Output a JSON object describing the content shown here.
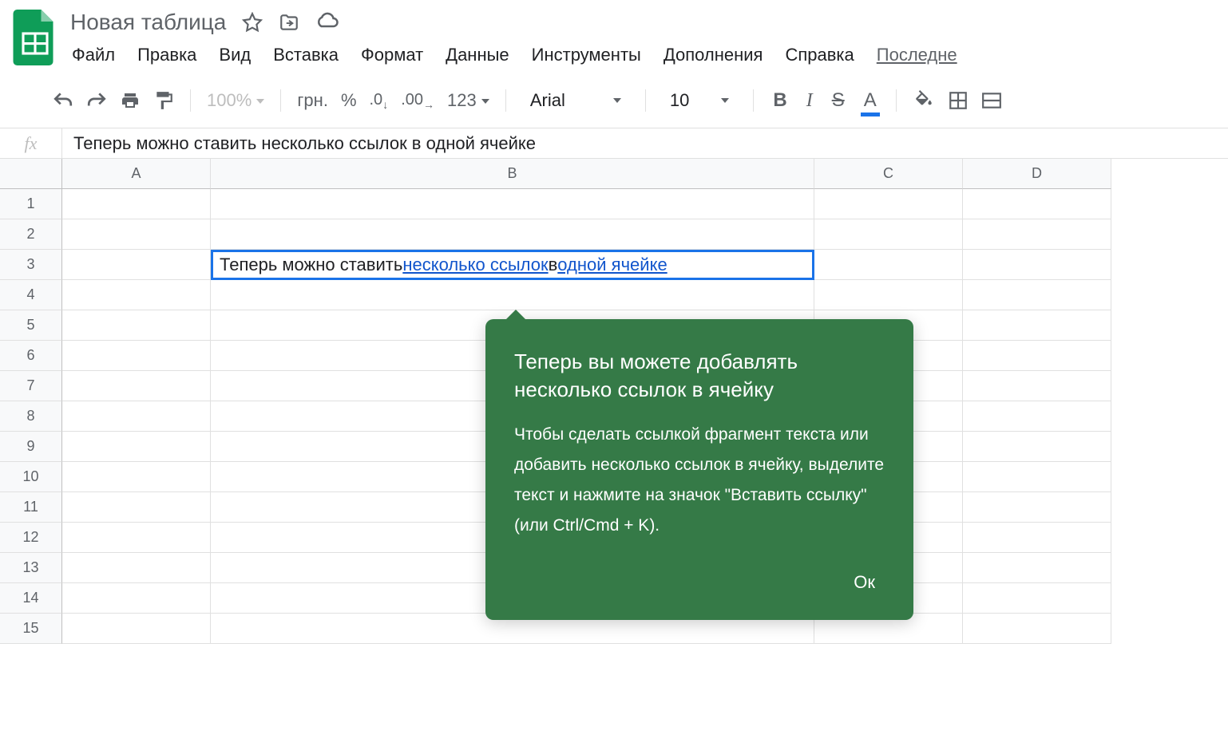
{
  "header": {
    "title": "Новая таблица"
  },
  "menu": {
    "items": [
      "Файл",
      "Правка",
      "Вид",
      "Вставка",
      "Формат",
      "Данные",
      "Инструменты",
      "Дополнения",
      "Справка"
    ],
    "last": "Последне"
  },
  "toolbar": {
    "zoom": "100%",
    "currency": "грн.",
    "percent": "%",
    "dec_less": ".0",
    "dec_more": ".00",
    "num_format": "123",
    "font": "Arial",
    "size": "10",
    "bold": "B",
    "italic": "I",
    "strike": "S",
    "text_color": "A"
  },
  "formula_bar": {
    "fx": "fx",
    "value": "Теперь можно ставить несколько ссылок в одной ячейке"
  },
  "columns": [
    "A",
    "B",
    "C",
    "D"
  ],
  "rows": [
    "1",
    "2",
    "3",
    "4",
    "5",
    "6",
    "7",
    "8",
    "9",
    "10",
    "11",
    "12",
    "13",
    "14",
    "15"
  ],
  "selected_cell": {
    "prefix": "Теперь можно ставить ",
    "link1": "несколько ссылок",
    "mid": " в ",
    "link2": "одной ячейке"
  },
  "tooltip": {
    "title": "Теперь вы можете добавлять несколько ссылок в ячейку",
    "body": "Чтобы сделать ссылкой фрагмент текста или добавить несколько ссылок в ячейку, выделите текст и нажмите на значок \"Вставить ссылку\" (или Ctrl/Cmd + K).",
    "ok": "Ок"
  }
}
